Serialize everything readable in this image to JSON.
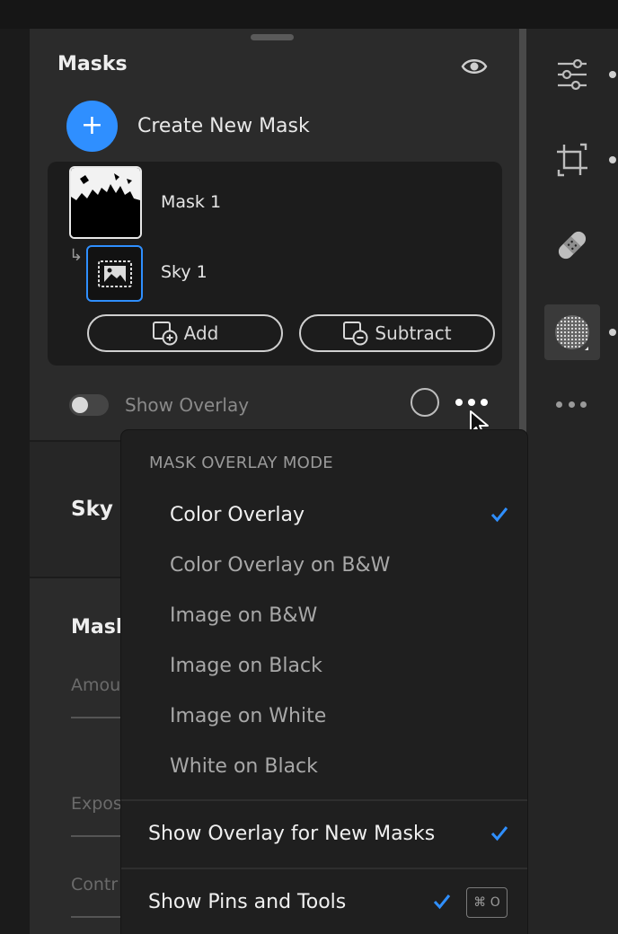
{
  "panel": {
    "title": "Masks",
    "create_label": "Create New Mask",
    "mask1_label": "Mask 1",
    "sky1_label": "Sky 1",
    "add_label": "Add",
    "subtract_label": "Subtract",
    "show_overlay_label": "Show Overlay",
    "show_overlay_on": false
  },
  "sections": {
    "sky_title": "Sky",
    "mask_title": "Masl",
    "amount_label": "Amou",
    "exposure_label": "Expos",
    "contrast_label": "Contr"
  },
  "menu": {
    "header": "MASK OVERLAY MODE",
    "modes": [
      {
        "label": "Color Overlay",
        "selected": true
      },
      {
        "label": "Color Overlay on B&W",
        "selected": false
      },
      {
        "label": "Image on B&W",
        "selected": false
      },
      {
        "label": "Image on Black",
        "selected": false
      },
      {
        "label": "Image on White",
        "selected": false
      },
      {
        "label": "White on Black",
        "selected": false
      }
    ],
    "show_new_masks_label": "Show Overlay for New Masks",
    "show_new_masks_checked": true,
    "show_pins_label": "Show Pins and Tools",
    "show_pins_checked": true,
    "show_pins_shortcut": "⌘ O"
  },
  "toolbar": {
    "tools": [
      "sliders-icon",
      "crop-icon",
      "bandage-icon",
      "masking-icon",
      "more-icon"
    ],
    "active_tool": "masking-icon"
  },
  "colors": {
    "accent": "#2f8fff",
    "panel_bg": "#2b2b2b",
    "menu_bg": "#1f1f1f"
  }
}
